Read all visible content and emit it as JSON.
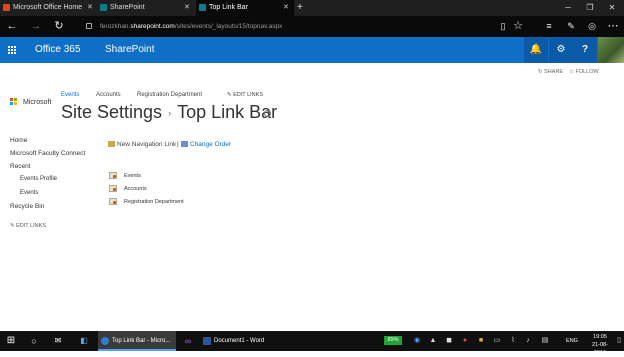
{
  "browser": {
    "tabs": [
      {
        "label": "Microsoft Office Home",
        "active": false
      },
      {
        "label": "SharePoint",
        "active": false
      },
      {
        "label": "Top Link Bar",
        "active": true
      }
    ],
    "new_tab": "+",
    "url_prefix": "ferozkhan.",
    "url_domain": "sharepoint.com",
    "url_path": "/sites/events/_layouts/15/topnav.aspx"
  },
  "suite": {
    "app_name": "Office 365",
    "site_name": "SharePoint",
    "icons": [
      "bell-icon",
      "gear-icon",
      "help-icon"
    ],
    "accent": "#0f6fc6"
  },
  "actions": {
    "share": "SHARE",
    "follow": "FOLLOW"
  },
  "topnav": {
    "logo_text": "Microsoft",
    "items": [
      "Events",
      "Accounts",
      "Registration Department"
    ],
    "edit_links": "EDIT LINKS"
  },
  "page": {
    "breadcrumb_root": "Site Settings",
    "separator": "›",
    "title": "Top Link Bar",
    "info": "i"
  },
  "quicklaunch": {
    "items": [
      "Home",
      "Microsoft Faculty Connect",
      "Recent",
      "Events Profile",
      "Events",
      "Recycle Bin"
    ],
    "edit_links": "EDIT LINKS"
  },
  "commands": {
    "new_link": "New Navigation Link",
    "divider": "|",
    "change_order": "Change Order"
  },
  "links": [
    "Events",
    "Accounts",
    "Registration Department"
  ],
  "taskbar": {
    "apps": [
      {
        "label": "Top Link Bar - Micro...",
        "active": true
      },
      {
        "label": "Document1 - Word",
        "active": false
      }
    ],
    "battery": "89%",
    "lang": "ENG",
    "time": "19:05",
    "date": "21-08-2016"
  }
}
